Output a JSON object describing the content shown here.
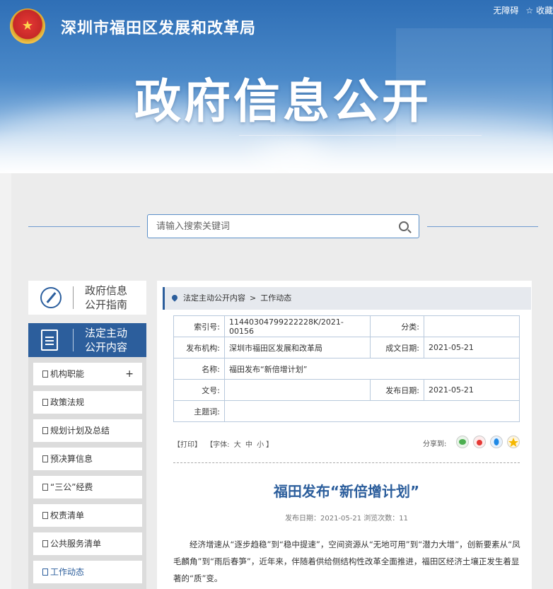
{
  "header": {
    "agency": "深圳市福田区发展和改革局",
    "links": [
      "无障碍",
      "☆ 收藏"
    ],
    "title": "政府信息公开"
  },
  "search": {
    "placeholder": "请输入搜索关键词"
  },
  "sidebar": {
    "guide": {
      "line1": "政府信息",
      "line2": "公开指南"
    },
    "active": {
      "line1": "法定主动",
      "line2": "公开内容"
    },
    "items": [
      {
        "label": "机构职能",
        "plus": "+"
      },
      {
        "label": "政策法规"
      },
      {
        "label": "规划计划及总结"
      },
      {
        "label": "预决算信息"
      },
      {
        "label": "“三公”经费"
      },
      {
        "label": "权责清单"
      },
      {
        "label": "公共服务清单"
      },
      {
        "label": "工作动态"
      }
    ]
  },
  "breadcrumb": {
    "level1": "法定主动公开内容",
    "sep": ">",
    "level2": "工作动态"
  },
  "meta": {
    "index_label": "索引号:",
    "index_value": "11440304799222228K/2021-00156",
    "category_label": "分类:",
    "category_value": "",
    "org_label": "发布机构:",
    "org_value": "深圳市福田区发展和改革局",
    "created_label": "成文日期:",
    "created_value": "2021-05-21",
    "name_label": "名称:",
    "name_value": "福田发布“新倍增计划”",
    "docno_label": "文号:",
    "docno_value": "",
    "pubdate_label": "发布日期:",
    "pubdate_value": "2021-05-21",
    "subject_label": "主题词:",
    "subject_value": ""
  },
  "tools": {
    "print": "【打印】",
    "font_prefix": "【字体:",
    "font_big": "大",
    "font_mid": "中",
    "font_small": "小",
    "font_suffix": "】",
    "share": "分享到:"
  },
  "article": {
    "title": "福田发布“新倍增计划”",
    "pubinfo": "发布日期：2021-05-21  浏览次数：11",
    "body": "经济增速从“逐步趋稳”到“稳中提速”，空间资源从“无地可用”到“潜力大增”，创新要素从“凤毛麟角”到“雨后春笋”，近年来，伴随着供给侧结构性改革全面推进，福田区经济土壤正发生着显著的“质”变。"
  },
  "colors": {
    "brand": "#2c5e9c",
    "title": "#2c5e9c",
    "wechat": "#4caf50",
    "weibo": "#e53935",
    "qq": "#1e88e5",
    "qzone": "#f5b700"
  }
}
